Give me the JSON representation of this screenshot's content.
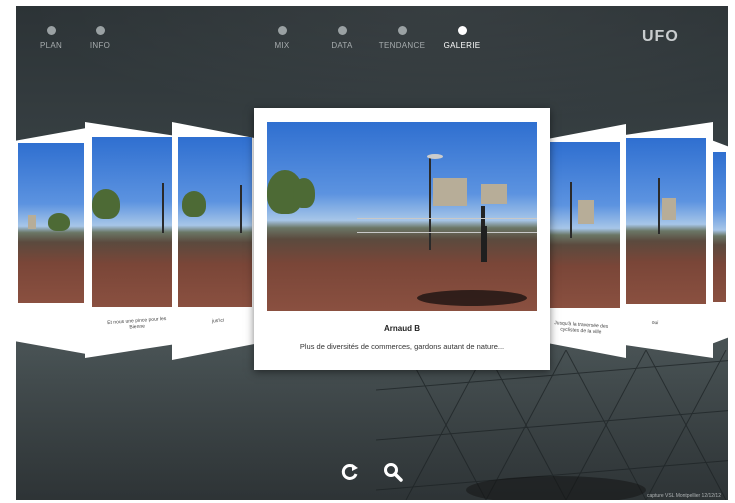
{
  "nav": {
    "left": [
      {
        "label": "PLAN",
        "active": false
      },
      {
        "label": "INFO",
        "active": false
      }
    ],
    "center": [
      {
        "label": "MIX",
        "active": false
      },
      {
        "label": "DATA",
        "active": false
      },
      {
        "label": "TENDANCE",
        "active": false
      },
      {
        "label": "GALERIE",
        "active": true
      }
    ],
    "logo": "UFO"
  },
  "gallery": {
    "featured": {
      "name": "Arnaud B",
      "comment": "Plus de diversités de commerces, gardons autant de nature..."
    },
    "side_left_captions": [
      "Et nous une pince pour les Bienne",
      "jus'ici"
    ],
    "side_right_captions": [
      "Jusqu'à la traversée des cyclistes de la ville",
      "oui"
    ]
  },
  "toolbar": {
    "refresh_icon": "refresh-icon",
    "search_icon": "search-icon"
  },
  "footer": {
    "credit": "capture VSL Montpellier 12/12/12"
  },
  "colors": {
    "active_nav": "#ffffff",
    "inactive_nav": "#9aa1a3",
    "background": "#3b4447"
  }
}
